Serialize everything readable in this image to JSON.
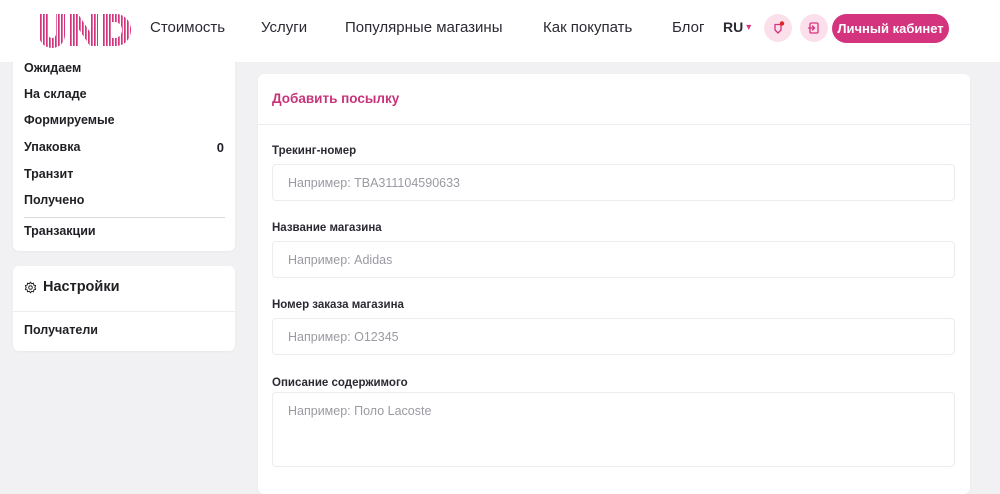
{
  "header": {
    "logo_text": "UND",
    "nav": [
      "Стоимость",
      "Услуги",
      "Популярные магазины",
      "Как покупать",
      "Блог"
    ],
    "lang": "RU",
    "cabinet_label": "Личный кабинет"
  },
  "sidebar": {
    "items": [
      {
        "label": "Ожидаем"
      },
      {
        "label": "На складе"
      },
      {
        "label": "Формируемые"
      },
      {
        "label": "Упаковка",
        "count": "0"
      },
      {
        "label": "Транзит"
      },
      {
        "label": "Получено"
      }
    ],
    "transactions": "Транзакции",
    "settings_title": "Настройки",
    "recipients": "Получатели"
  },
  "form": {
    "title": "Добавить посылку",
    "tracking": {
      "label": "Трекинг-номер",
      "placeholder": "Например: TBA311104590633",
      "value": ""
    },
    "store": {
      "label": "Название магазина",
      "placeholder": "Например: Adidas",
      "value": ""
    },
    "order": {
      "label": "Номер заказа магазина",
      "placeholder": "Например: O12345",
      "value": ""
    },
    "description": {
      "label": "Описание содержимого",
      "placeholder": "Например: Поло Lacoste",
      "value": ""
    }
  },
  "colors": {
    "accent": "#d4337e",
    "accent_light": "#fbe0ec",
    "background": "#f1f1f3"
  }
}
